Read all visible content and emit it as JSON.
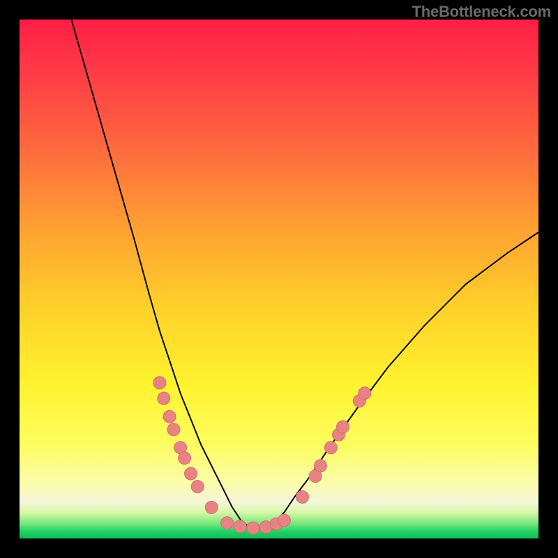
{
  "watermark": "TheBottleneck.com",
  "colors": {
    "background": "#000000",
    "curve_stroke": "#000000",
    "dot_fill": "#e98383",
    "dot_stroke": "#d06f6f",
    "gradient_top": "#ff1f45",
    "gradient_bottom": "#0dbc57"
  },
  "chart_data": {
    "type": "line",
    "title": "",
    "xlabel": "",
    "ylabel": "",
    "xlim": [
      0,
      100
    ],
    "ylim": [
      0,
      100
    ],
    "grid": false,
    "note": "Axes unlabeled; x and y normalized 0–100. Curve is a V-shaped bottleneck profile with minimum near x≈44, y≈2. Left branch starts near top-left at y≈100; right branch ends at right edge near y≈59.",
    "series": [
      {
        "name": "bottleneck-curve",
        "x": [
          10,
          14,
          18,
          22,
          25,
          27,
          29,
          31,
          33,
          35,
          37,
          39,
          41,
          43,
          45,
          47,
          49,
          51,
          53,
          56,
          60,
          65,
          71,
          78,
          86,
          94,
          100
        ],
        "y": [
          100,
          86,
          72,
          58,
          47,
          40,
          34,
          28,
          23,
          18,
          14,
          10,
          6,
          3,
          2,
          2,
          3,
          5,
          8,
          12,
          18,
          25,
          33,
          41,
          49,
          55,
          59
        ]
      }
    ],
    "marker_clusters": [
      {
        "name": "left-branch-dots",
        "points": [
          {
            "x": 27.0,
            "y": 30.0
          },
          {
            "x": 27.8,
            "y": 27.0
          },
          {
            "x": 28.9,
            "y": 23.5
          },
          {
            "x": 29.7,
            "y": 21.0
          },
          {
            "x": 31.0,
            "y": 17.5
          },
          {
            "x": 31.8,
            "y": 15.5
          },
          {
            "x": 33.0,
            "y": 12.5
          },
          {
            "x": 34.3,
            "y": 10.0
          },
          {
            "x": 37.0,
            "y": 6.0
          }
        ]
      },
      {
        "name": "bottom-dots",
        "points": [
          {
            "x": 40.0,
            "y": 3.0
          },
          {
            "x": 42.5,
            "y": 2.3
          },
          {
            "x": 45.0,
            "y": 2.0
          },
          {
            "x": 47.5,
            "y": 2.2
          },
          {
            "x": 49.5,
            "y": 2.8
          },
          {
            "x": 51.0,
            "y": 3.5
          }
        ]
      },
      {
        "name": "right-branch-dots",
        "points": [
          {
            "x": 54.5,
            "y": 8.0
          },
          {
            "x": 57.0,
            "y": 12.0
          },
          {
            "x": 58.0,
            "y": 14.0
          },
          {
            "x": 60.0,
            "y": 17.5
          },
          {
            "x": 61.5,
            "y": 20.0
          },
          {
            "x": 62.3,
            "y": 21.5
          },
          {
            "x": 65.5,
            "y": 26.5
          },
          {
            "x": 66.5,
            "y": 28.0
          }
        ]
      }
    ]
  }
}
